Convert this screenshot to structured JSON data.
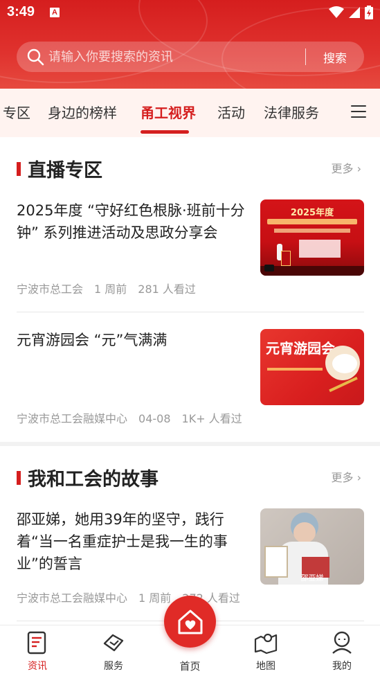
{
  "status_bar": {
    "time": "3:49",
    "notification_badge": "A"
  },
  "search": {
    "placeholder": "请输入你要搜索的资讯",
    "button_label": "搜索"
  },
  "tabs": [
    {
      "label": "专区",
      "active": false
    },
    {
      "label": "身边的榜样",
      "active": false
    },
    {
      "label": "甬工视界",
      "active": true
    },
    {
      "label": "活动",
      "active": false
    },
    {
      "label": "法律服务",
      "active": false
    }
  ],
  "sections": [
    {
      "title": "直播专区",
      "more_label": "更多",
      "items": [
        {
          "title": "2025年度 “守好红色根脉·班前十分钟” 系列推进活动及思政分享会",
          "source": "宁波市总工会",
          "time": "1 周前",
          "views": "281 人看过",
          "thumb_caption": "2025年度"
        },
        {
          "title": "元宵游园会 “元”气满满",
          "source": "宁波市总工会融媒中心",
          "time": "04-08",
          "views": "1K+ 人看过",
          "thumb_caption": "元宵游园会"
        }
      ]
    },
    {
      "title": "我和工会的故事",
      "more_label": "更多",
      "items": [
        {
          "title": "邵亚娣，她用39年的坚守，践行着“当一名重症护士是我一生的事业”的誓言",
          "source": "宁波市总工会融媒中心",
          "time": "1 周前",
          "views": "272 人看过",
          "thumb_caption": "邵亚娣"
        }
      ]
    }
  ],
  "tab_bar": {
    "items": [
      {
        "label": "资讯",
        "icon": "news-icon",
        "active": true
      },
      {
        "label": "服务",
        "icon": "service-icon",
        "active": false
      },
      {
        "label": "首页",
        "icon": "home-heart-icon",
        "active": false
      },
      {
        "label": "地图",
        "icon": "map-icon",
        "active": false
      },
      {
        "label": "我的",
        "icon": "profile-icon",
        "active": false
      }
    ]
  },
  "colors": {
    "brand_red": "#d51e1e",
    "tab_bg": "#fff3f0",
    "meta_gray": "#999999"
  }
}
